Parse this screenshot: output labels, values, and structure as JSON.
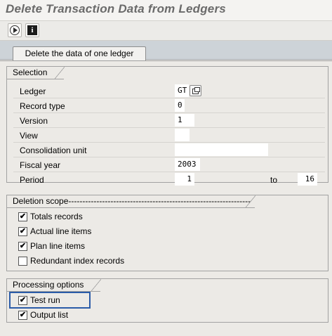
{
  "window": {
    "title": "Delete Transaction Data from Ledgers"
  },
  "toolbar": {
    "execute_icon": "execute-icon",
    "info_icon": "info-icon"
  },
  "tab": {
    "label": "Delete the data of one ledger"
  },
  "selection": {
    "title": "Selection",
    "ledger": {
      "label": "Ledger",
      "value": "GT"
    },
    "record_type": {
      "label": "Record type",
      "value": "0"
    },
    "version": {
      "label": "Version",
      "value": "1"
    },
    "view": {
      "label": "View",
      "value": ""
    },
    "consolidation_unit": {
      "label": "Consolidation unit",
      "value": ""
    },
    "fiscal_year": {
      "label": "Fiscal year",
      "value": "2003"
    },
    "period": {
      "label": "Period",
      "from_value": "1",
      "to_label": "to",
      "to_value": "16"
    }
  },
  "deletion_scope": {
    "title": "Deletion scope-----------------------------------------------------------------",
    "options": [
      {
        "label": "Totals records",
        "checked": "✔"
      },
      {
        "label": "Actual line items",
        "checked": "✔"
      },
      {
        "label": "Plan line items",
        "checked": "✔"
      },
      {
        "label": "Redundant index records",
        "checked": ""
      }
    ]
  },
  "processing": {
    "title": "Processing options",
    "options": [
      {
        "label": "Test run",
        "checked": "✔"
      },
      {
        "label": "Output list",
        "checked": "✔"
      }
    ]
  }
}
